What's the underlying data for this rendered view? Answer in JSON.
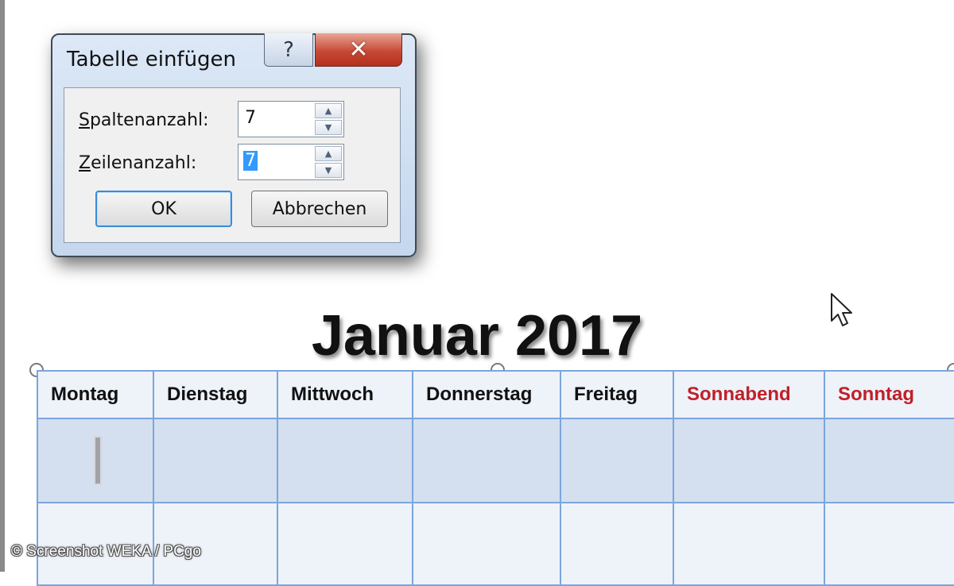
{
  "dialog": {
    "title": "Tabelle einfügen",
    "help_glyph": "?",
    "close_glyph": "✕",
    "columns": {
      "label_access_key": "S",
      "label_rest": "paltenanzahl:",
      "value": "7"
    },
    "rows": {
      "label_access_key": "Z",
      "label_rest": "eilenanzahl:",
      "value": "7"
    },
    "ok_label": "OK",
    "cancel_label": "Abbrechen",
    "spin_up": "▲",
    "spin_down": "▼"
  },
  "calendar": {
    "title": "Januar 2017",
    "weekdays": [
      "Montag",
      "Dienstag",
      "Mittwoch",
      "Donnerstag",
      "Freitag",
      "Sonnabend",
      "Sonntag"
    ],
    "weekend_color": "#c0202a",
    "border_color": "#7aa6dc"
  },
  "watermark": "© Screenshot WEKA / PCgo"
}
